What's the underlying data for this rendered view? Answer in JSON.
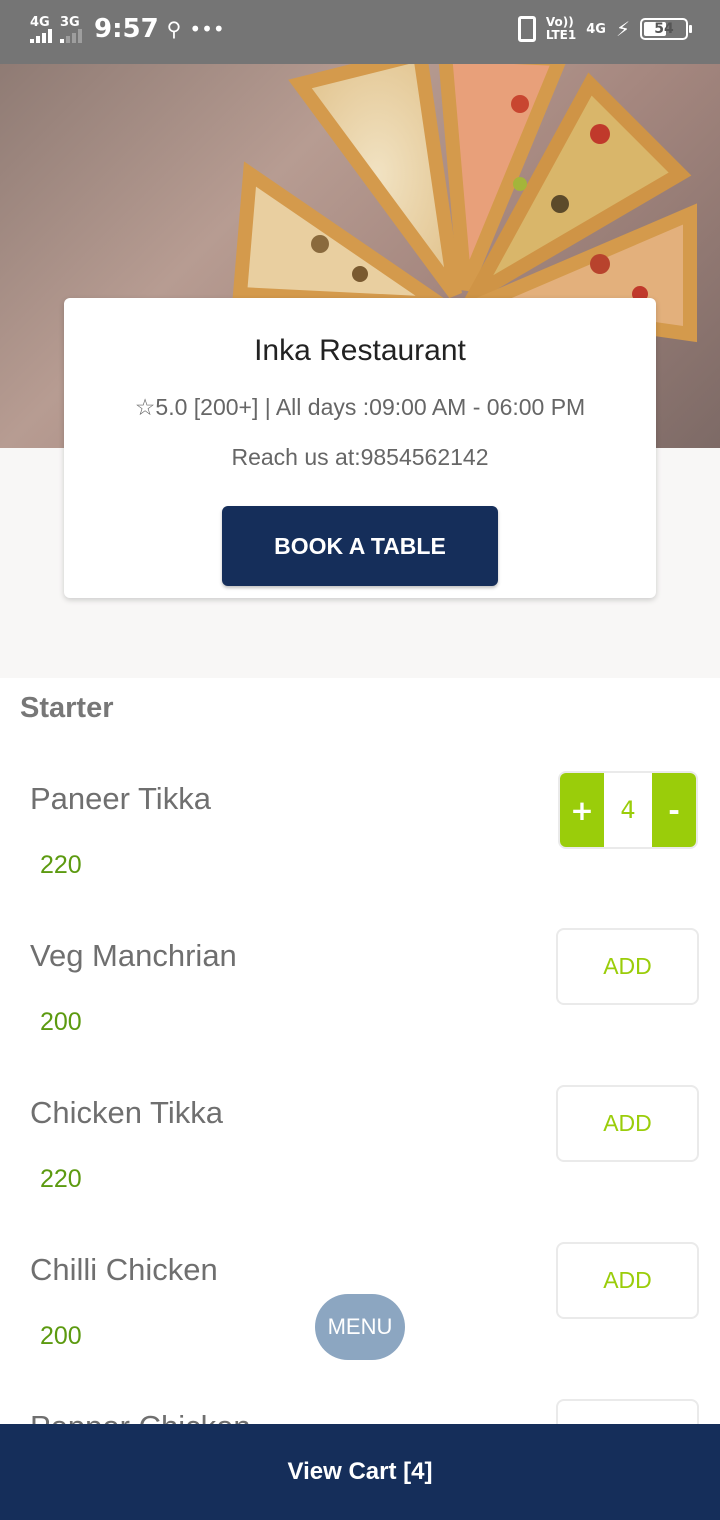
{
  "status_bar": {
    "network_1": "4G",
    "network_2": "3G",
    "time": "9:57",
    "usb_icon": "usb-icon",
    "more_icon": "more-dots-icon",
    "volte_top": "Vo))",
    "volte_bottom": "LTE1",
    "network_3": "4G",
    "battery_level": "54"
  },
  "restaurant": {
    "name": "Inka Restaurant",
    "rating_icon": "star-outline-icon",
    "rating_line": "5.0 [200+] | All days :09:00 AM - 06:00 PM",
    "contact": "Reach us at:9854562142",
    "book_label": "BOOK A TABLE"
  },
  "menu": {
    "section": "Starter",
    "items": [
      {
        "name": "Paneer Tikka",
        "price": "220",
        "in_cart": true,
        "qty": "4",
        "plus": "+",
        "minus": "-"
      },
      {
        "name": "Veg Manchrian",
        "price": "200",
        "add_label": "ADD"
      },
      {
        "name": "Chicken Tikka",
        "price": "220",
        "add_label": "ADD"
      },
      {
        "name": "Chilli Chicken",
        "price": "200",
        "add_label": "ADD"
      },
      {
        "name": "Pepper Chicken"
      }
    ]
  },
  "menu_button": "MENU",
  "cart": {
    "label": "View Cart [4]"
  },
  "colors": {
    "primary": "#152e5a",
    "accent_green": "#9acd0a",
    "price_green": "#5c9a10",
    "status_bar": "#757575"
  }
}
